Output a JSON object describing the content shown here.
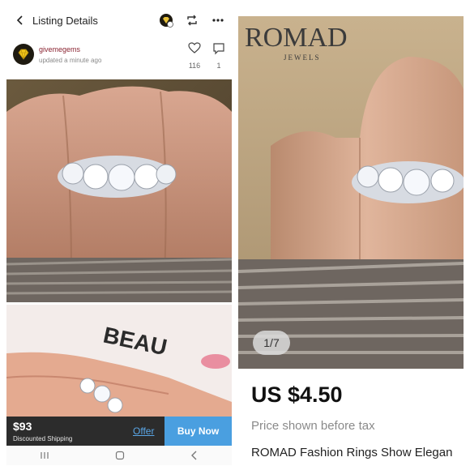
{
  "listing": {
    "header": {
      "title": "Listing Details"
    },
    "post": {
      "username": "givemegems",
      "updated": "updated a minute ago",
      "likes": "116",
      "comments": "1"
    },
    "purchase": {
      "price": "$93",
      "shipping": "Discounted Shipping",
      "offer_label": "Offer",
      "buy_label": "Buy Now"
    },
    "photo_caption_text": "BEAU"
  },
  "product": {
    "brand": "ROMAD",
    "brand_sub": "JEWELS",
    "pager": "1/7",
    "price": "US $4.50",
    "price_note": "Price shown before tax",
    "title": "ROMAD Fashion Rings Show Elegan"
  },
  "colors": {
    "username": "#8a2432",
    "buy_button": "#4a9fe0",
    "offer_link": "#5aa6e6",
    "price_bar": "#2c2c2c"
  }
}
